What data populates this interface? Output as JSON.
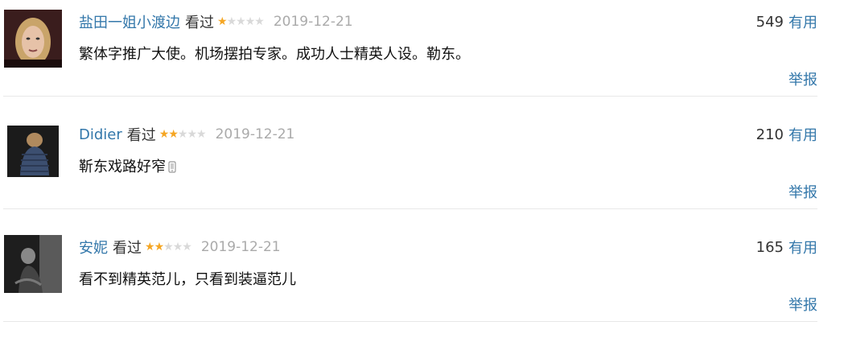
{
  "comments": [
    {
      "username": "盐田一姐小渡边",
      "status": "看过",
      "rating": 1,
      "date": "2019-12-21",
      "votes": "549",
      "useful_label": "有用",
      "text": "繁体字推广大使。机场摆拍专家。成功人士精英人设。勒东。",
      "report_label": "举报"
    },
    {
      "username": "Didier",
      "status": "看过",
      "rating": 2,
      "date": "2019-12-21",
      "votes": "210",
      "useful_label": "有用",
      "text": "靳东戏路好窄",
      "report_label": "举报"
    },
    {
      "username": "安妮",
      "status": "看过",
      "rating": 2,
      "date": "2019-12-21",
      "votes": "165",
      "useful_label": "有用",
      "text": "看不到精英范儿，只看到装逼范儿",
      "report_label": "举报"
    }
  ],
  "colors": {
    "link": "#3377aa",
    "star_on": "#f5a623",
    "star_off": "#d9d9d9",
    "date": "#aaaaaa"
  }
}
